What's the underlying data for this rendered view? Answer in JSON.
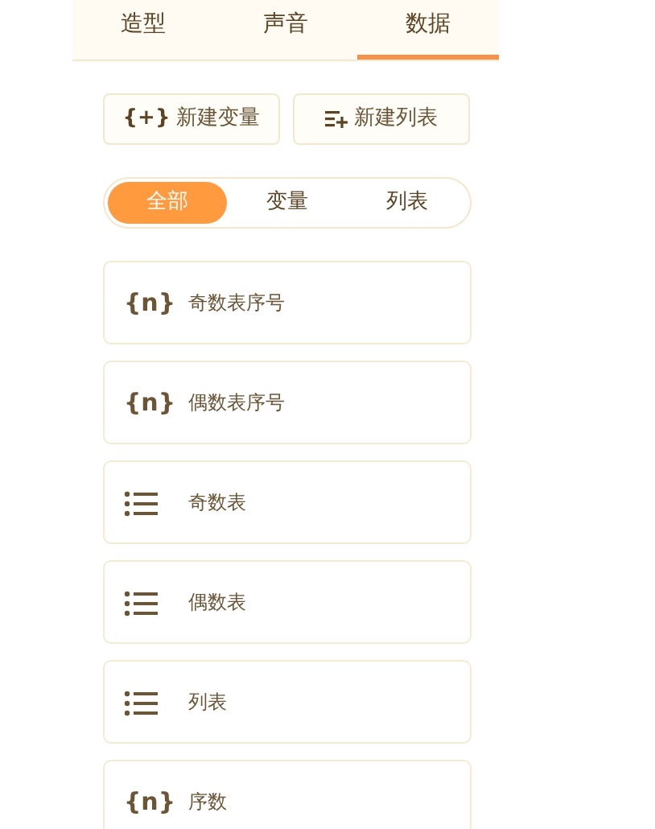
{
  "tabs": [
    {
      "label": "造型",
      "selected": false
    },
    {
      "label": "声音",
      "selected": false
    },
    {
      "label": "数据",
      "selected": true
    }
  ],
  "actions": [
    {
      "kind": "variable",
      "symbol": "{+}",
      "label": "新建变量"
    },
    {
      "kind": "list",
      "label": "新建列表"
    }
  ],
  "filters": [
    {
      "label": "全部",
      "selected": true
    },
    {
      "label": "变量",
      "selected": false
    },
    {
      "label": "列表",
      "selected": false
    }
  ],
  "items": [
    {
      "kind": "variable",
      "symbol": "{n}",
      "name": "奇数表序号"
    },
    {
      "kind": "variable",
      "symbol": "{n}",
      "name": "偶数表序号"
    },
    {
      "kind": "list",
      "name": "奇数表"
    },
    {
      "kind": "list",
      "name": "偶数表"
    },
    {
      "kind": "list",
      "name": "列表"
    },
    {
      "kind": "variable",
      "symbol": "{n}",
      "name": "序数"
    }
  ]
}
